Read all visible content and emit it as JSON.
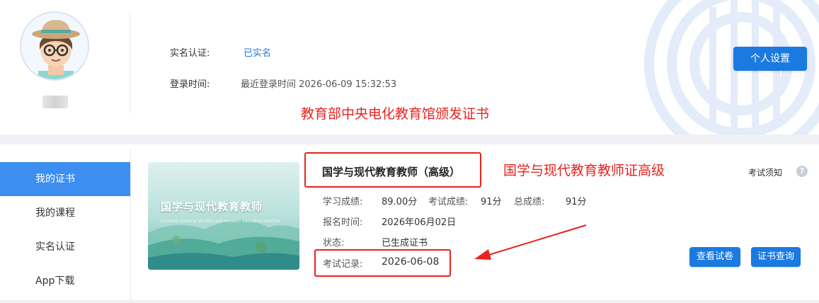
{
  "header": {
    "realname_label": "实名认证:",
    "realname_value": "已实名",
    "login_label": "登录时间:",
    "login_value": "最近登录时间 2026-06-09 15:32:53",
    "settings_button": "个人设置",
    "annotation_issuer": "教育部中央电化教育馆颁发证书"
  },
  "sidebar": {
    "items": [
      {
        "label": "我的证书",
        "active": true
      },
      {
        "label": "我的课程",
        "active": false
      },
      {
        "label": "实名认证",
        "active": false
      },
      {
        "label": "App下载",
        "active": false
      }
    ]
  },
  "course": {
    "cover_title": "国学与现代教育教师",
    "cover_subtitle": "Chinese classical studies and modern education teacher",
    "title": "国学与现代教育教师（高级）",
    "annotation_level": "国学与现代教育教师证高级",
    "study_score_label": "学习成绩:",
    "study_score_value": "89.00分",
    "exam_score_label": "考试成绩:",
    "exam_score_value": "91分",
    "total_score_label": "总成绩:",
    "total_score_value": "91分",
    "signup_label": "报名时间:",
    "signup_value": "2026年06月02日",
    "status_label": "状态:",
    "status_value": "已生成证书",
    "exam_record_label": "考试记录:",
    "exam_record_value": "2026-06-08",
    "notice_label": "考试须知",
    "help_icon": "?",
    "view_paper_button": "查看试卷",
    "cert_query_button": "证书查询"
  },
  "colors": {
    "primary": "#1a7ae0",
    "active_sidebar": "#3c8ef0",
    "annotation_red": "#e8231f"
  }
}
